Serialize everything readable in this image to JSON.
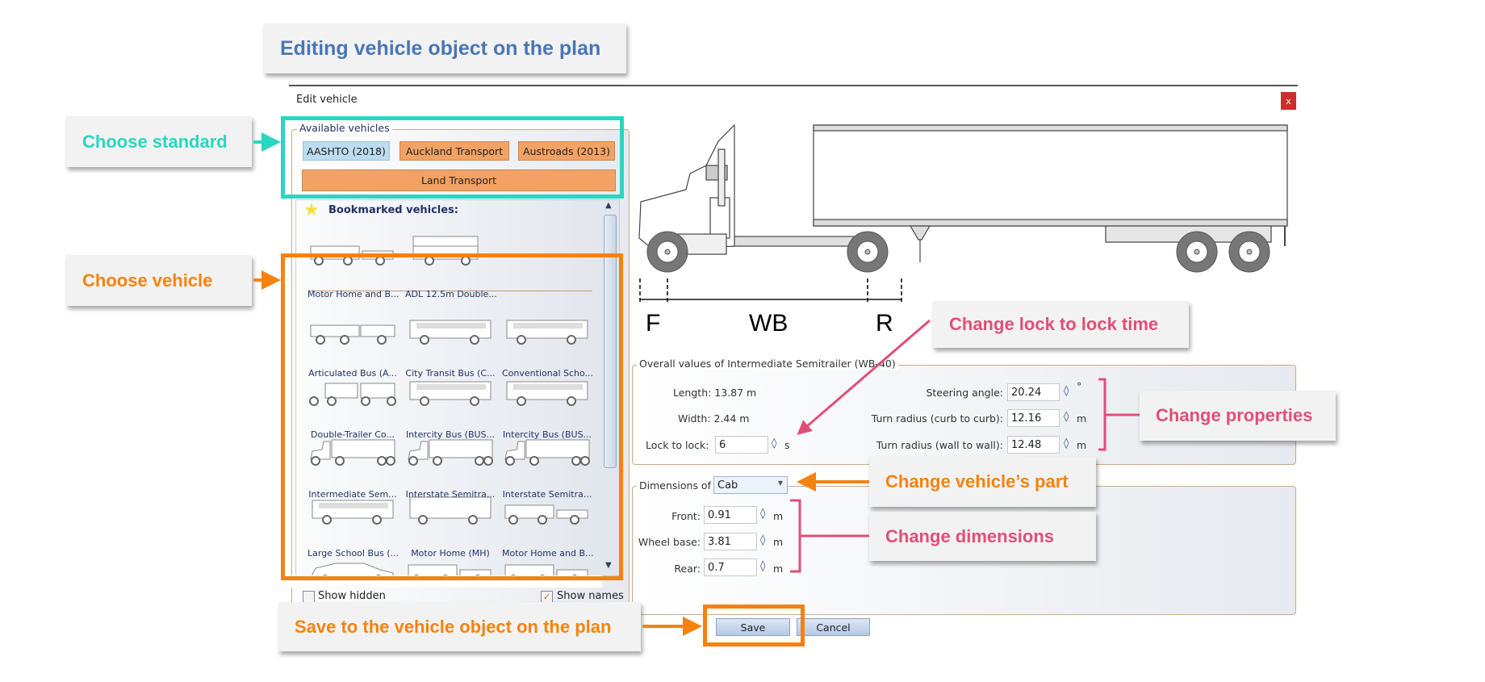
{
  "annotations": {
    "title": "Editing vehicle object on the plan",
    "choose_standard": "Choose standard",
    "choose_vehicle": "Choose vehicle",
    "change_lock": "Change lock to lock time",
    "change_properties": "Change properties",
    "change_part": "Change vehicle’s part",
    "change_dimensions": "Change dimensions",
    "save_to_plan": "Save to the vehicle object on the plan",
    "colors": {
      "teal": "#2ad6c2",
      "orange": "#f5820f",
      "pink": "#e04f78",
      "blue": "#4a76b6"
    }
  },
  "dialog": {
    "title": "Edit vehicle",
    "close_label": "x",
    "available": {
      "legend": "Available vehicles",
      "standards": [
        {
          "label": "AASHTO (2018)",
          "selected": true
        },
        {
          "label": "Auckland Transport",
          "selected": false
        },
        {
          "label": "Austroads (2013)",
          "selected": false
        },
        {
          "label": "Land Transport",
          "selected": false
        }
      ]
    },
    "bookmarked_heading": "Bookmarked vehicles:",
    "bookmarked": [
      {
        "label": "Motor Home and B...",
        "icon": "motorhome-boat"
      },
      {
        "label": "ADL 12.5m Double...",
        "icon": "double-decker"
      }
    ],
    "vehicles": [
      {
        "label": "Articulated Bus (A...",
        "icon": "articulated-bus"
      },
      {
        "label": "City Transit Bus (C...",
        "icon": "bus"
      },
      {
        "label": "Conventional Scho...",
        "icon": "school-bus"
      },
      {
        "label": "Double-Trailer Co...",
        "icon": "double-trailer"
      },
      {
        "label": "Intercity Bus (BUS...",
        "icon": "coach"
      },
      {
        "label": "Intercity Bus (BUS...",
        "icon": "coach"
      },
      {
        "label": "Intermediate Sem...",
        "icon": "semitrailer"
      },
      {
        "label": "Interstate Semitra...",
        "icon": "semitrailer"
      },
      {
        "label": "Interstate Semitra...",
        "icon": "semitrailer"
      },
      {
        "label": "Large School Bus (...",
        "icon": "bus"
      },
      {
        "label": "Motor Home (MH)",
        "icon": "motorhome"
      },
      {
        "label": "Motor Home and B...",
        "icon": "motorhome-boat"
      },
      {
        "label": "",
        "icon": "car"
      },
      {
        "label": "",
        "icon": "car-boat"
      },
      {
        "label": "",
        "icon": "car-camper"
      }
    ],
    "show_hidden": {
      "label": "Show hidden",
      "checked": false
    },
    "show_names": {
      "label": "Show names",
      "checked": true
    },
    "diagram": {
      "f": "F",
      "wb": "WB",
      "r": "R"
    },
    "overall": {
      "legend": "Overall values of Intermediate Semitrailer (WB-40)",
      "length": "Length: 13.87  m",
      "width": "Width: 2.44  m",
      "lock_label": "Lock to lock:",
      "lock_value": "6",
      "lock_unit": "s",
      "steering_label": "Steering angle:",
      "steering_value": "20.24",
      "steering_unit": "°",
      "curb_label": "Turn radius (curb to curb):",
      "curb_value": "12.16",
      "curb_unit": "m",
      "wall_label": "Turn radius (wall to wall):",
      "wall_value": "12.48",
      "wall_unit": "m"
    },
    "dimensions": {
      "legend": "Dimensions of",
      "part": "Cab",
      "front_label": "Front:",
      "front_value": "0.91",
      "wheelbase_label": "Wheel base:",
      "wheelbase_value": "3.81",
      "rear_label": "Rear:",
      "rear_value": "0.7",
      "unit": "m"
    },
    "spinner_glyph": "◊",
    "save_label": "Save",
    "cancel_label": "Cancel"
  }
}
